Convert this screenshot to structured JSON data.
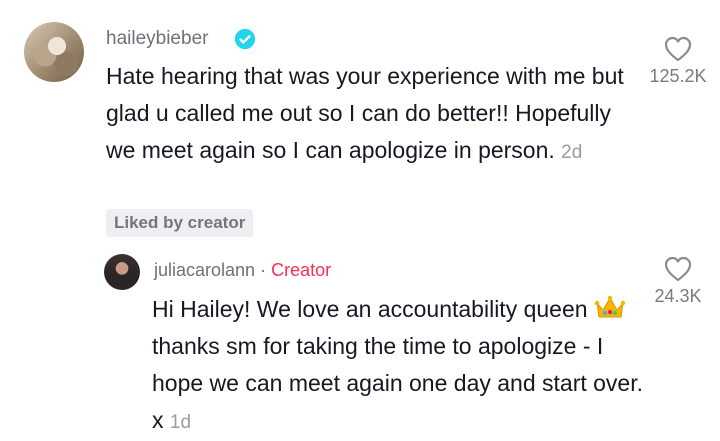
{
  "comment": {
    "username": "haileybieber",
    "text": "Hate hearing that was your experience with me but glad u called me out so I can do better!! Hopefully we meet again so I can apologize in person.",
    "time": "2d",
    "like_count": "125.2K",
    "liked_badge": "Liked by creator",
    "verified_color": "#20d5ec"
  },
  "reply": {
    "username": "juliacarolann",
    "separator": "·",
    "creator_label": "Creator",
    "text_before_emoji": "Hi Hailey! We love an accountability queen",
    "emoji_icon": "crown-emoji",
    "text_after_emoji": "thanks sm for taking the time to apologize - I hope we can meet again one day and start over. x",
    "time": "1d",
    "like_count": "24.3K"
  },
  "colors": {
    "creator_accent": "#fe2c55",
    "muted_text": "#6f7079"
  }
}
